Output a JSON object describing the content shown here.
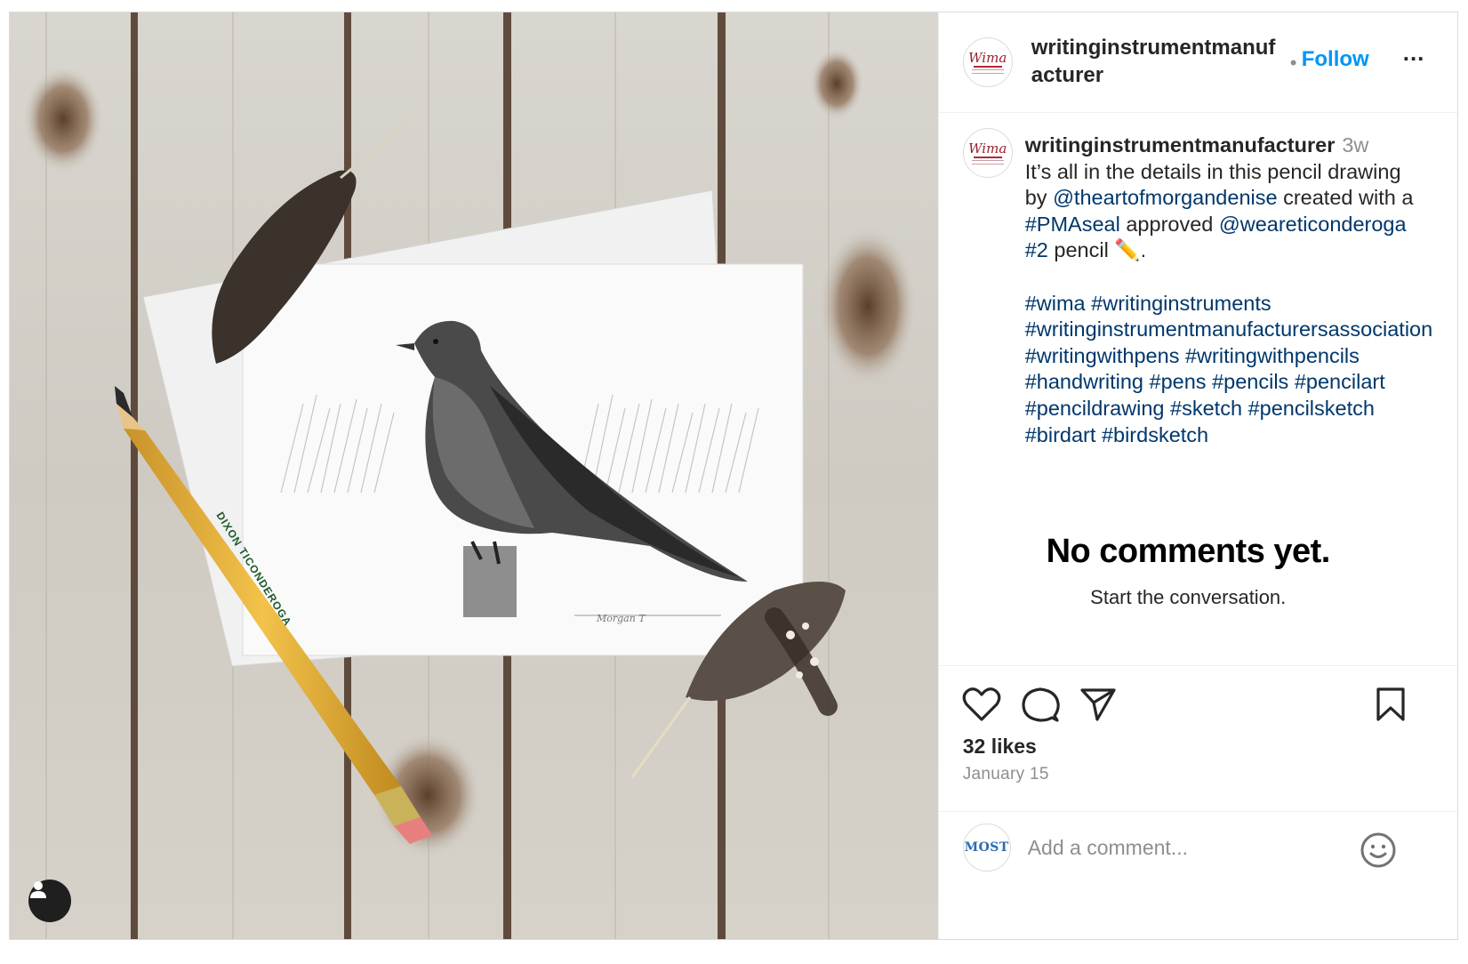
{
  "post": {
    "username": "writinginstrumentmanufacturer",
    "header_username": "writinginstrumentmanuf acturer",
    "follow_label": "Follow",
    "dot": "•",
    "more_label": "...",
    "avatar_logo_text": "Wima",
    "time_ago": "3w",
    "caption": {
      "line1": "It’s all in the details in this pencil drawing by ",
      "mention1": "@theartofmorgandenise",
      "text2": " created with a ",
      "hashtag_seal": "#PMAseal",
      "text3": " approved ",
      "mention2": "@weareticonderoga",
      "text4": " ",
      "hashtag_2": "#2",
      "text5": " pencil ✏️."
    },
    "hashtags": [
      "#wima",
      "#writinginstruments",
      "#writinginstrumentmanufacturersassociation",
      "#writingwithpens",
      "#writingwithpencils",
      "#handwriting",
      "#pens",
      "#pencils",
      "#pencilart",
      "#pencildrawing",
      "#sketch",
      "#pencilsketch",
      "#birdart",
      "#birdsketch"
    ],
    "no_comments_title": "No comments yet.",
    "no_comments_sub": "Start the conversation.",
    "likes": "32 likes",
    "date": "January 15",
    "comment_placeholder": "Add a comment...",
    "my_avatar_text": "MOST"
  },
  "image": {
    "pencil_brand": "DIXON TICONDEROGA",
    "signature": "Morgan T"
  },
  "icons": [
    "heart-icon",
    "comment-icon",
    "share-icon",
    "bookmark-icon",
    "emoji-icon",
    "user-tag-icon"
  ],
  "colors": {
    "link": "#00376b",
    "follow": "#0095f6",
    "muted": "#8e8e8e"
  }
}
